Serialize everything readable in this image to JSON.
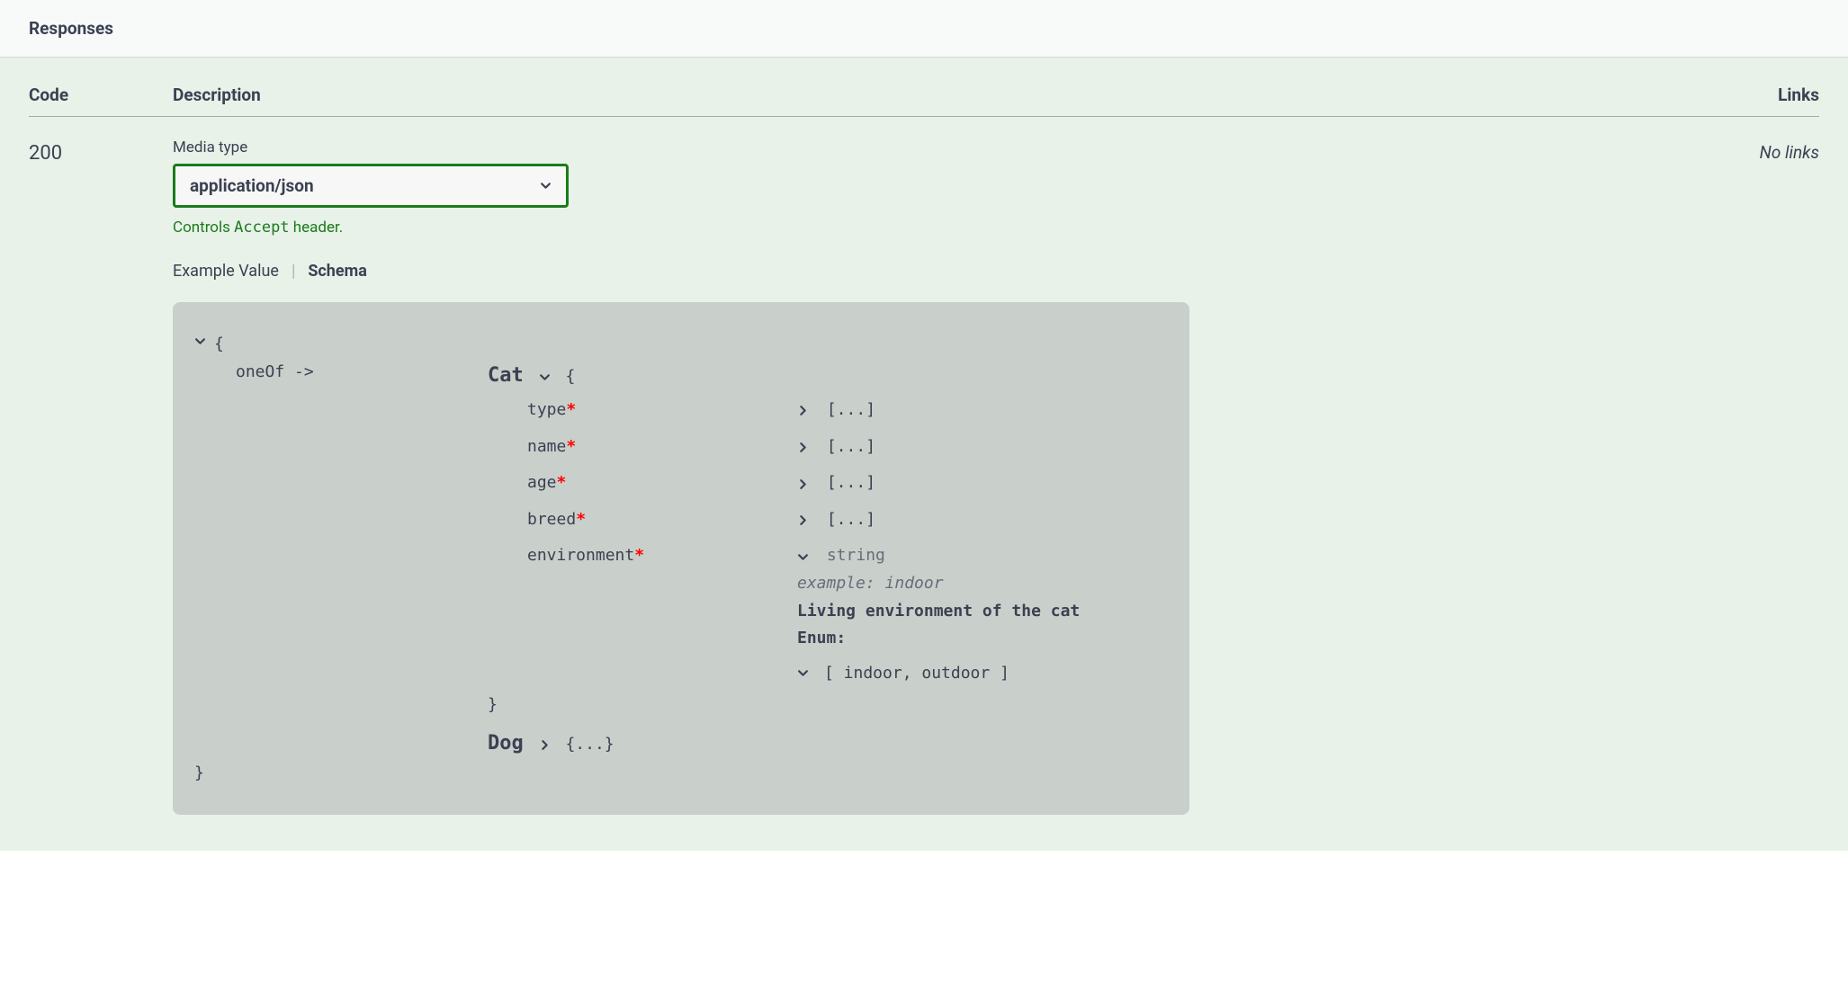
{
  "header": {
    "title": "Responses"
  },
  "columns": {
    "code": "Code",
    "description": "Description",
    "links": "Links"
  },
  "response": {
    "code": "200",
    "links": "No links",
    "media_type_label": "Media type",
    "media_type_value": "application/json",
    "controls_hint_pre": "Controls ",
    "controls_hint_code": "Accept",
    "controls_hint_post": " header.",
    "tabs": {
      "example": "Example Value",
      "schema": "Schema"
    }
  },
  "schema": {
    "open_brace": "{",
    "close_brace": "}",
    "oneof": "oneOf ->",
    "cat": {
      "name": "Cat",
      "open": " {",
      "close": "}",
      "props": {
        "type": "type",
        "name": "name",
        "age": "age",
        "breed": "breed",
        "environment": "environment"
      },
      "collapsed": "[...]",
      "env": {
        "type": "string",
        "example_label": "example: ",
        "example_value": "indoor",
        "desc": "Living environment of the cat",
        "enum_label": "Enum:",
        "enum_values": "[ indoor, outdoor ]"
      }
    },
    "dog": {
      "name": "Dog",
      "collapsed": "{...}"
    }
  }
}
